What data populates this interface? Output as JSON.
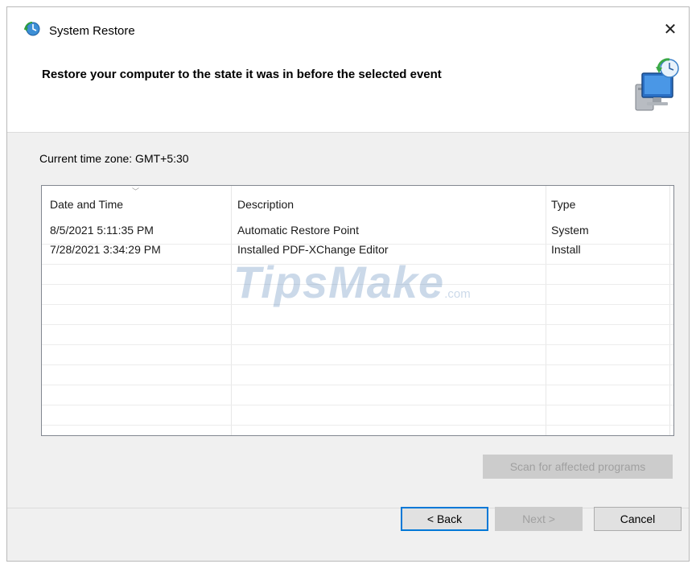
{
  "window": {
    "title": "System Restore",
    "close_glyph": "✕"
  },
  "header": {
    "heading": "Restore your computer to the state it was in before the selected event"
  },
  "timezone": {
    "label": "Current time zone: GMT+5:30"
  },
  "table": {
    "columns": [
      "Date and Time",
      "Description",
      "Type"
    ],
    "sorted_column": "Date and Time",
    "rows": [
      {
        "date": "8/5/2021 5:11:35 PM",
        "description": "Automatic Restore Point",
        "type": "System"
      },
      {
        "date": "7/28/2021 3:34:29 PM",
        "description": "Installed PDF-XChange Editor",
        "type": "Install"
      }
    ]
  },
  "watermark": {
    "text": "TipsMake",
    "suffix": ".com"
  },
  "buttons": {
    "scan": "Scan for affected programs",
    "back": "< Back",
    "next": "Next >",
    "cancel": "Cancel"
  },
  "icons": {
    "app": "system-restore-icon",
    "hero": "computer-restore-icon",
    "sort": "sort-descending-icon",
    "close": "close-icon"
  },
  "colors": {
    "window_bg": "#f0f0f0",
    "focus_border": "#0078d7",
    "disabled_text": "#a0a0a0",
    "watermark": "#4678af"
  }
}
